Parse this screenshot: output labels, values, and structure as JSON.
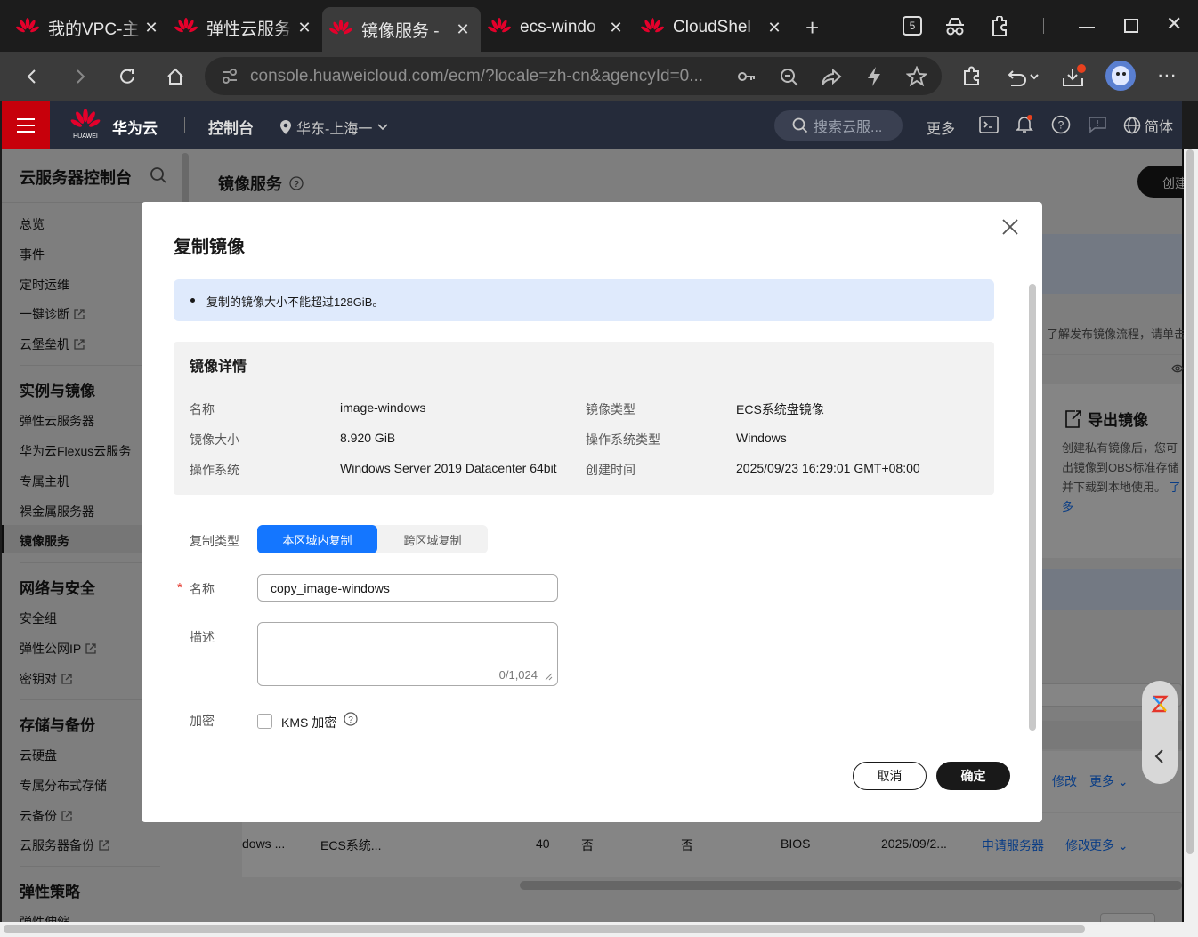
{
  "browser": {
    "tabs": [
      {
        "title": "我的VPC-主"
      },
      {
        "title": "弹性云服务"
      },
      {
        "title": "镜像服务 -"
      },
      {
        "title": "ecs-windo"
      },
      {
        "title": "CloudShel"
      }
    ],
    "url": "console.huaweicloud.com/ecm/?locale=zh-cn&agencyId=0...",
    "tab_count_badge": "5"
  },
  "header": {
    "brand": "华为云",
    "logo_text": "HUAWEI",
    "console": "控制台",
    "region": "华东-上海一",
    "search_placeholder": "搜索云服...",
    "more": "更多",
    "lang": "简体"
  },
  "sidebar": {
    "title": "云服务器控制台",
    "top_items": [
      "总览",
      "事件",
      "定时运维",
      "一键诊断",
      "云堡垒机"
    ],
    "groups": [
      {
        "title": "实例与镜像",
        "items": [
          "弹性云服务器",
          "华为云Flexus云服务",
          "专属主机",
          "裸金属服务器",
          "镜像服务"
        ]
      },
      {
        "title": "网络与安全",
        "items": [
          "安全组",
          "弹性公网IP",
          "密钥对"
        ]
      },
      {
        "title": "存储与备份",
        "items": [
          "云硬盘",
          "专属分布式存储",
          "云备份",
          "云服务器备份"
        ]
      },
      {
        "title": "弹性策略",
        "items": [
          "弹性伸缩"
        ]
      }
    ]
  },
  "main": {
    "title": "镜像服务",
    "create_btn": "创建",
    "publish_hint": "了解发布镜像流程，请单击",
    "export": {
      "title": "导出镜像",
      "text_lines": [
        "创建私有镜像后，您可",
        "出镜像到OBS标准存储",
        "并下载到本地使用。"
      ],
      "link1": "了",
      "link2": "多"
    },
    "row_actions_1": {
      "modify": "修改",
      "more": "更多"
    },
    "row": {
      "name": "dows ...",
      "type": "ECS系统...",
      "size": "40",
      "c1": "否",
      "c2": "否",
      "boot": "BIOS",
      "time": "2025/09/2...",
      "apply": "申请服务器",
      "modify": "修改",
      "more": "更多"
    }
  },
  "dialog": {
    "title": "复制镜像",
    "notice": "复制的镜像大小不能超过128GiB。",
    "details_title": "镜像详情",
    "details": {
      "name_label": "名称",
      "name_value": "image-windows",
      "type_label": "镜像类型",
      "type_value": "ECS系统盘镜像",
      "size_label": "镜像大小",
      "size_value": "8.920 GiB",
      "ostype_label": "操作系统类型",
      "ostype_value": "Windows",
      "os_label": "操作系统",
      "os_value": "Windows Server 2019 Datacenter 64bit",
      "created_label": "创建时间",
      "created_value": "2025/09/23 16:29:01 GMT+08:00"
    },
    "copy_type_label": "复制类型",
    "copy_type_options": [
      "本区域内复制",
      "跨区域复制"
    ],
    "copy_type_selected": "本区域内复制",
    "name_label": "名称",
    "required_mark": "*",
    "name_value": "copy_image-windows",
    "desc_label": "描述",
    "desc_counter": "0/1,024",
    "encrypt_label": "加密",
    "kms_label": "KMS 加密",
    "cancel": "取消",
    "confirm": "确定"
  },
  "colors": {
    "brand_red": "#c7000b",
    "primary_blue": "#1476ff",
    "notice_bg": "#e0ecfc",
    "header_bg": "#252b3a"
  }
}
